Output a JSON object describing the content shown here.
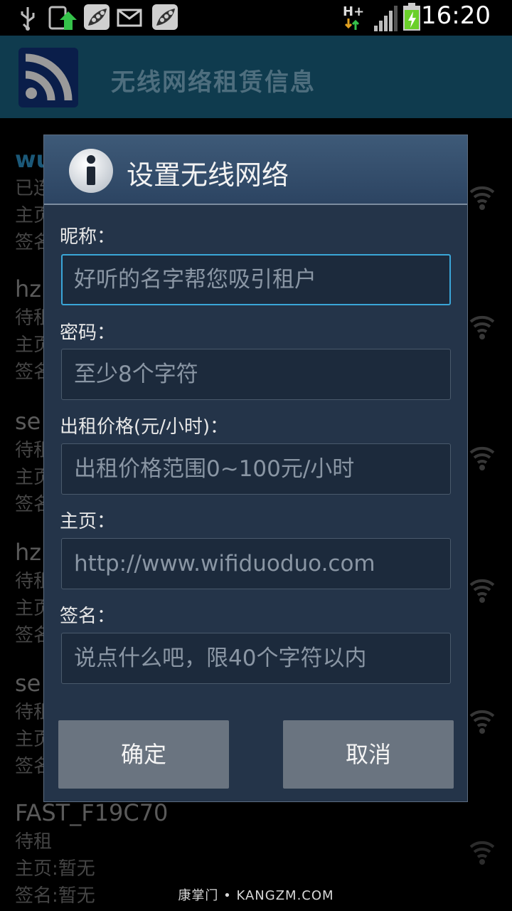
{
  "status_bar": {
    "time": "16:20",
    "network_type": "H+",
    "icons": [
      "usb-icon",
      "upload-app-icon",
      "peapod-icon",
      "mail-icon",
      "peapod-icon",
      "network-arrows-icon",
      "signal-icon",
      "battery-charging-icon"
    ]
  },
  "app_bar": {
    "title": "无线网络租赁信息",
    "logo_icon": "rss-wifi-icon"
  },
  "networks": [
    {
      "name": "wu",
      "status": "已连",
      "homepage": "主页",
      "signature": "签名"
    },
    {
      "name": "hz",
      "status": "待租",
      "homepage": "主页",
      "signature": "签名"
    },
    {
      "name": "se",
      "status": "待租",
      "homepage": "主页",
      "signature": "签名"
    },
    {
      "name": "hz",
      "status": "待租",
      "homepage": "主页",
      "signature": "签名"
    },
    {
      "name": "se",
      "status": "待租",
      "homepage": "主页",
      "signature": "签名"
    },
    {
      "name": "FAST_F19C70",
      "status": "待租",
      "homepage": "主页:暂无",
      "signature": "签名:暂无"
    }
  ],
  "dialog": {
    "title": "设置无线网络",
    "fields": [
      {
        "label": "昵称：",
        "placeholder": "好听的名字帮您吸引租户"
      },
      {
        "label": "密码：",
        "placeholder": "至少8个字符"
      },
      {
        "label": "出租价格(元/小时)：",
        "placeholder": "出租价格范围0~100元/小时"
      },
      {
        "label": "主页：",
        "placeholder": "http://www.wifiduoduo.com"
      },
      {
        "label": "签名：",
        "placeholder": "说点什么吧，限40个字符以内"
      }
    ],
    "confirm_label": "确定",
    "cancel_label": "取消"
  },
  "watermark": "康掌门 • KANGZM.COM",
  "colors": {
    "app_bar": "#0f3b4e",
    "dialog_bg": "#243449",
    "focus_border": "#3aa6d8",
    "button": "#6a7480",
    "connected_text": "#2a88b8"
  }
}
